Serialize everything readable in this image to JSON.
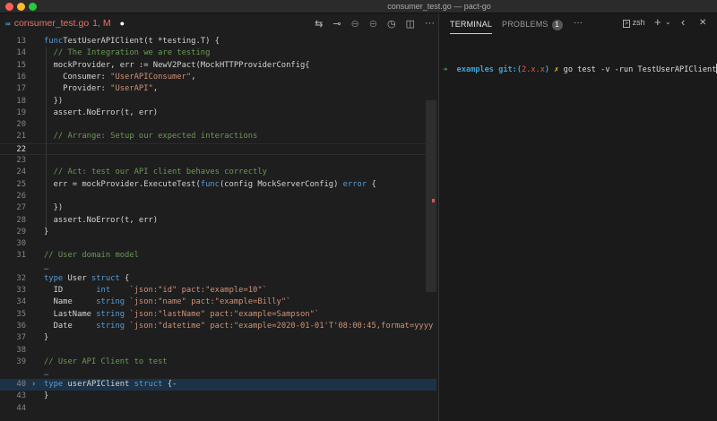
{
  "window": {
    "title": "consumer_test.go — pact-go"
  },
  "editor_tab": {
    "icon": "go-file-icon",
    "filename": "consumer_test.go",
    "status": "1, M",
    "modified": "●"
  },
  "actions": [
    {
      "name": "compare-changes-icon",
      "glyph": "⇆"
    },
    {
      "name": "go-to-previous-change-icon",
      "glyph": "⊸"
    },
    {
      "name": "go-back-icon",
      "glyph": "⊖"
    },
    {
      "name": "go-forward-icon",
      "glyph": "⊖"
    },
    {
      "name": "timeline-icon",
      "glyph": "◷"
    },
    {
      "name": "split-editor-icon",
      "glyph": "◫"
    },
    {
      "name": "more-actions-icon",
      "glyph": "···"
    }
  ],
  "code_rows": [
    {
      "ln": "13",
      "t": [
        [
          "kw",
          "func"
        ],
        [
          "",
          "TestUserAPIClient(t *testing.T) {"
        ]
      ]
    },
    {
      "ln": "14",
      "t": [
        [
          "",
          "  "
        ],
        [
          "cm",
          "// The Integration we are testing"
        ]
      ]
    },
    {
      "ln": "15",
      "t": [
        [
          "",
          "  mockProvider, err := NewV2Pact(MockHTTPProviderConfig{"
        ]
      ]
    },
    {
      "ln": "16",
      "t": [
        [
          "",
          "    Consumer: "
        ],
        [
          "str",
          "\"UserAPIConsumer\""
        ],
        [
          "",
          ","
        ]
      ]
    },
    {
      "ln": "17",
      "t": [
        [
          "",
          "    Provider: "
        ],
        [
          "str",
          "\"UserAPI\""
        ],
        [
          "",
          ","
        ]
      ]
    },
    {
      "ln": "18",
      "t": [
        [
          "",
          "  })"
        ]
      ]
    },
    {
      "ln": "19",
      "t": [
        [
          "",
          "  assert.NoError(t, err)"
        ]
      ]
    },
    {
      "ln": "20",
      "t": []
    },
    {
      "ln": "21",
      "t": [
        [
          "",
          "  "
        ],
        [
          "cm",
          "// Arrange: Setup our expected interactions"
        ]
      ]
    },
    {
      "ln": "22",
      "t": [],
      "current": true
    },
    {
      "ln": "23",
      "t": []
    },
    {
      "ln": "24",
      "t": [
        [
          "",
          "  "
        ],
        [
          "cm",
          "// Act: test our API client behaves correctly"
        ]
      ]
    },
    {
      "ln": "25",
      "t": [
        [
          "",
          "  err = mockProvider.ExecuteTest("
        ],
        [
          "kw",
          "func"
        ],
        [
          "",
          "(config MockServerConfig) "
        ],
        [
          "kw",
          "error"
        ],
        [
          "",
          " {"
        ]
      ]
    },
    {
      "ln": "26",
      "t": []
    },
    {
      "ln": "27",
      "t": [
        [
          "",
          "  })"
        ]
      ]
    },
    {
      "ln": "28",
      "t": [
        [
          "",
          "  assert.NoError(t, err)"
        ]
      ]
    },
    {
      "ln": "29",
      "t": [
        [
          "",
          "}"
        ]
      ]
    },
    {
      "ln": "30",
      "t": []
    },
    {
      "ln": "31",
      "t": [
        [
          "cm",
          "// User domain model"
        ]
      ]
    },
    {
      "ln": "",
      "t": [
        [
          "dots",
          "…"
        ]
      ],
      "small": true
    },
    {
      "ln": "32",
      "t": [
        [
          "kw",
          "type"
        ],
        [
          "",
          " User "
        ],
        [
          "kw",
          "struct"
        ],
        [
          "",
          " {"
        ]
      ]
    },
    {
      "ln": "33",
      "t": [
        [
          "",
          "  ID       "
        ],
        [
          "kw",
          "int"
        ],
        [
          "",
          "    "
        ],
        [
          "str",
          "`json:\"id\" pact:\"example=10\"`"
        ]
      ]
    },
    {
      "ln": "34",
      "t": [
        [
          "",
          "  Name     "
        ],
        [
          "kw",
          "string"
        ],
        [
          "",
          " "
        ],
        [
          "str",
          "`json:\"name\" pact:\"example=Billy\"`"
        ]
      ]
    },
    {
      "ln": "35",
      "t": [
        [
          "",
          "  LastName "
        ],
        [
          "kw",
          "string"
        ],
        [
          "",
          " "
        ],
        [
          "str",
          "`json:\"lastName\" pact:\"example=Sampson\"`"
        ]
      ]
    },
    {
      "ln": "36",
      "t": [
        [
          "",
          "  Date     "
        ],
        [
          "kw",
          "string"
        ],
        [
          "",
          " "
        ],
        [
          "str",
          "`json:\"datetime\" pact:\"example=2020-01-01'T'08:00:45,format=yyyy"
        ]
      ]
    },
    {
      "ln": "37",
      "t": [
        [
          "",
          "}"
        ]
      ]
    },
    {
      "ln": "38",
      "t": []
    },
    {
      "ln": "39",
      "t": [
        [
          "cm",
          "// User API Client to test"
        ]
      ]
    },
    {
      "ln": "",
      "t": [
        [
          "dots",
          "…"
        ]
      ],
      "small": true
    },
    {
      "ln": "40",
      "t": [
        [
          "kw",
          "type"
        ],
        [
          "",
          " userAPIClient "
        ],
        [
          "kw",
          "struct"
        ],
        [
          "",
          " {-"
        ]
      ],
      "folded": true
    },
    {
      "ln": "43",
      "t": [
        [
          "",
          "}"
        ]
      ]
    },
    {
      "ln": "44",
      "t": []
    }
  ],
  "panel": {
    "tabs": [
      {
        "label": "TERMINAL",
        "active": true
      },
      {
        "label": "PROBLEMS",
        "count": "1"
      }
    ],
    "more": "···",
    "shell": "zsh",
    "add": "+",
    "dropdown": "⌄",
    "back": "‹",
    "close": "✕"
  },
  "terminal": {
    "arrow": "➜",
    "dir": "examples",
    "git": "git:(",
    "branch": "2.x.x",
    "git_close": ")",
    "dirty": "✗",
    "command": "go test -v -run TestUserAPIClient"
  },
  "colors": {
    "keyword": "#569cd6",
    "string": "#ce9178",
    "comment": "#6a9955",
    "tab_modified": "#e8736a"
  }
}
